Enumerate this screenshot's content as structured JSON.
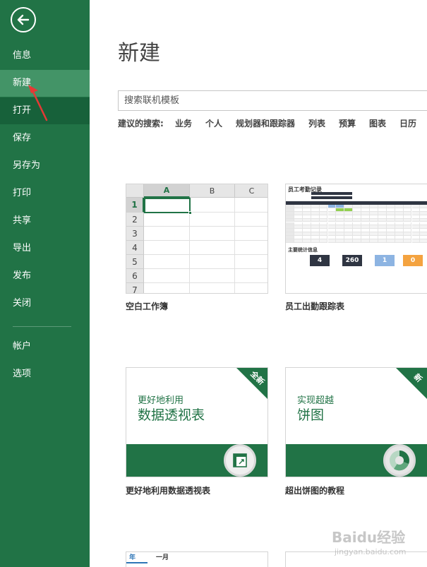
{
  "sidebar": {
    "items": [
      {
        "label": "信息"
      },
      {
        "label": "新建"
      },
      {
        "label": "打开"
      },
      {
        "label": "保存"
      },
      {
        "label": "另存为"
      },
      {
        "label": "打印"
      },
      {
        "label": "共享"
      },
      {
        "label": "导出"
      },
      {
        "label": "发布"
      },
      {
        "label": "关闭"
      },
      {
        "label": "帐户"
      },
      {
        "label": "选项"
      }
    ]
  },
  "main": {
    "title": "新建",
    "search": {
      "placeholder": "搜索联机模板"
    },
    "suggested_label": "建议的搜索:",
    "suggestions": [
      "业务",
      "个人",
      "规划器和跟踪器",
      "列表",
      "预算",
      "图表",
      "日历"
    ]
  },
  "templates": [
    {
      "caption": "空白工作簿",
      "columns": [
        "A",
        "B",
        "C"
      ],
      "rows": [
        "1",
        "2",
        "3",
        "4",
        "5",
        "6",
        "7"
      ]
    },
    {
      "caption": "员工出勤跟踪表",
      "title": "员工考勤记录",
      "section": "主要统计信息",
      "cards": [
        {
          "value": "4",
          "color": "#2f3542"
        },
        {
          "value": "260",
          "color": "#2f3542"
        },
        {
          "value": "1",
          "color": "#8db4e2"
        },
        {
          "value": "0",
          "color": "#f4a340"
        }
      ]
    },
    {
      "caption": "更好地利用数据透视表",
      "line1": "更好地利用",
      "line2": "数据透视表",
      "badge": "全新"
    },
    {
      "caption": "超出饼图的教程",
      "line1": "实现超越",
      "line2": "饼图",
      "badge": "新"
    },
    {
      "year_label": "年",
      "month_label": "一月"
    }
  ],
  "watermark": {
    "text": "Baidu经验",
    "sub": "jingyan.baidu.com"
  },
  "colors": {
    "accent": "#217346",
    "active": "#439467",
    "annotation": "#e53935"
  }
}
